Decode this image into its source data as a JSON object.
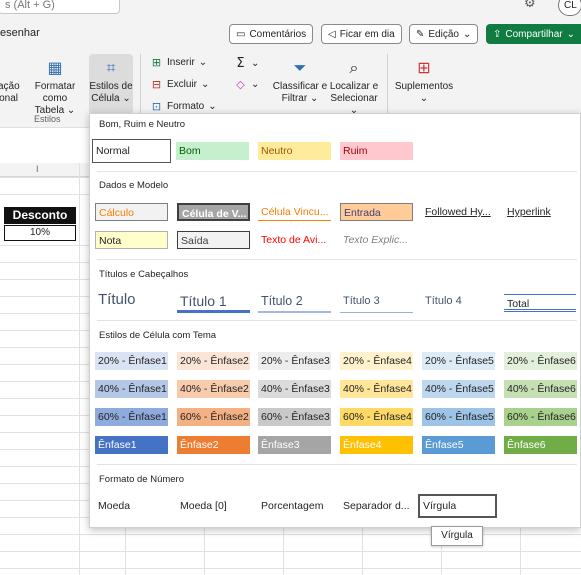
{
  "topbar": {
    "search_text": "s (Alt + G)",
    "avatar_initials": "CL"
  },
  "tabs": {
    "draw_label": "esenhar"
  },
  "actions": {
    "comments": "Comentários",
    "call": "Ficar em dia",
    "editing": "Edição",
    "share": "Compartilhar"
  },
  "ribbon": {
    "cond_format": [
      "ação",
      "onal"
    ],
    "format_table": [
      "Formatar como",
      "Tabela"
    ],
    "cell_styles": [
      "Estilos de",
      "Célula"
    ],
    "styles_group": "Estilos",
    "insert": "Inserir",
    "delete": "Excluir",
    "format": "Formato",
    "sort_filter": [
      "Classificar e",
      "Filtrar"
    ],
    "find_select": [
      "Localizar e",
      "Selecionar"
    ],
    "addins": "Suplementos"
  },
  "sheet": {
    "column_letter": "I",
    "header_cell": "Desconto",
    "value_cell": "10%"
  },
  "gallery": {
    "sec_good_bad": "Bom, Ruim e Neutro",
    "good_bad": [
      "Normal",
      "Bom",
      "Neutro",
      "Ruim"
    ],
    "sec_data": "Dados e Modelo",
    "data_row1": [
      "Cálculo",
      "Célula de V...",
      "Célula Vincu...",
      "Entrada",
      "Followed Hy...",
      "Hyperlink"
    ],
    "data_row2": [
      "Nota",
      "Saída",
      "Texto de Avi...",
      "Texto Explic..."
    ],
    "sec_titles": "Títulos e Cabeçalhos",
    "titles": [
      "Título",
      "Título 1",
      "Título 2",
      "Título 3",
      "Título 4",
      "Total"
    ],
    "sec_theme": "Estilos de Célula com Tema",
    "theme_20": [
      "20% - Ênfase1",
      "20% - Ênfase2",
      "20% - Ênfase3",
      "20% - Ênfase4",
      "20% - Ênfase5",
      "20% - Ênfase6"
    ],
    "theme_40": [
      "40% - Ênfase1",
      "40% - Ênfase2",
      "40% - Ênfase3",
      "40% - Ênfase4",
      "40% - Ênfase5",
      "40% - Ênfase6"
    ],
    "theme_60": [
      "60% - Ênfase1",
      "60% - Ênfase2",
      "60% - Ênfase3",
      "60% - Ênfase4",
      "60% - Ênfase5",
      "60% - Ênfase6"
    ],
    "theme_full": [
      "Ênfase1",
      "Ênfase2",
      "Ênfase3",
      "Ênfase4",
      "Ênfase5",
      "Ênfase6"
    ],
    "sec_number": "Formato de Número",
    "number": [
      "Moeda",
      "Moeda [0]",
      "Porcentagem",
      "Separador d...",
      "Vírgula"
    ],
    "tooltip": "Vírgula"
  },
  "colors": {
    "share_green": "#107c41",
    "good_bg": "#c6efce",
    "good_fg": "#006100",
    "neutral_bg": "#ffeb9c",
    "neutral_fg": "#9c5700",
    "bad_bg": "#ffc7ce",
    "bad_fg": "#9c0006"
  }
}
